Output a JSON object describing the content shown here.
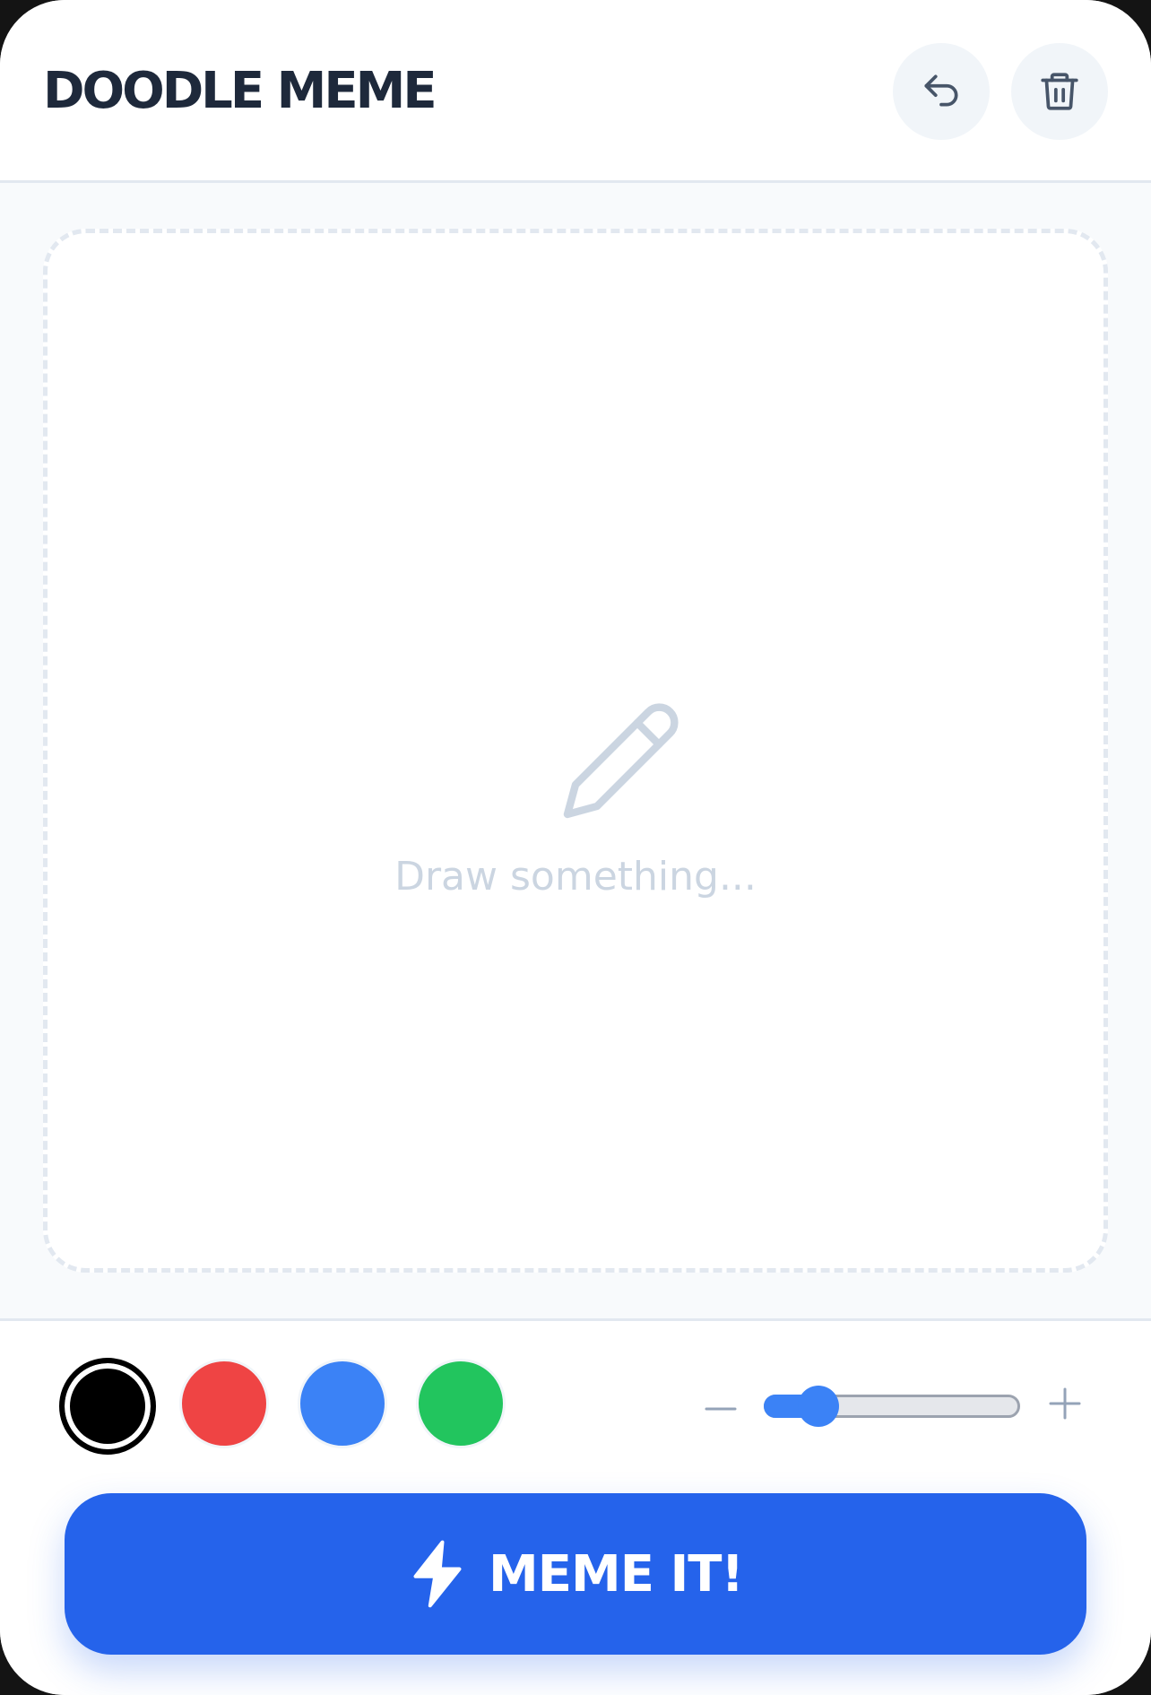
{
  "header": {
    "title": "DOODLE MEME",
    "undo_icon": "undo-icon",
    "trash_icon": "trash-icon"
  },
  "canvas": {
    "placeholder": "Draw something...",
    "placeholder_icon": "pencil-icon"
  },
  "toolbar": {
    "colors": [
      {
        "name": "black",
        "hex": "#000000",
        "selected": true
      },
      {
        "name": "red",
        "hex": "#ef4444",
        "selected": false
      },
      {
        "name": "blue",
        "hex": "#3b82f6",
        "selected": false
      },
      {
        "name": "green",
        "hex": "#22c55e",
        "selected": false
      }
    ],
    "brush_size": {
      "decrease_icon": "minus-icon",
      "increase_icon": "plus-icon",
      "level": 0.2
    },
    "action_button": {
      "label": "MEME IT!",
      "icon": "lightning-bolt-icon",
      "color": "#2563eb"
    }
  }
}
